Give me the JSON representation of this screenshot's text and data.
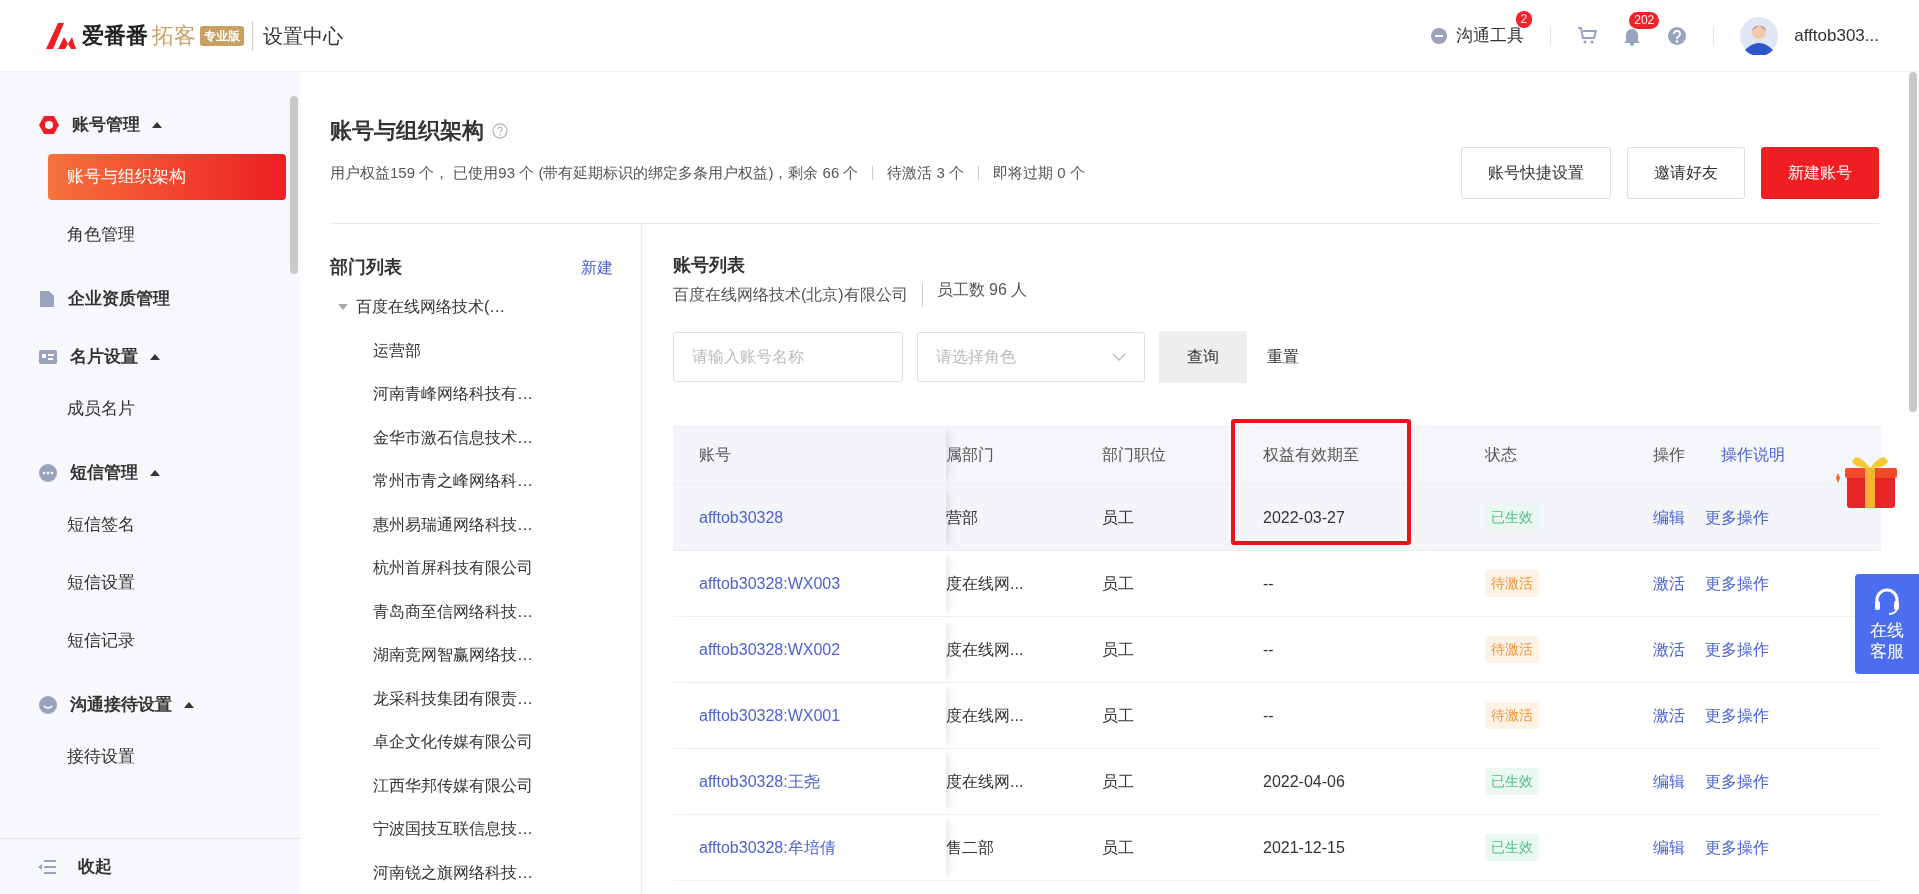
{
  "header": {
    "brand": "爱番番",
    "product": "拓客",
    "edition": "专业版",
    "section": "设置中心",
    "tools_label": "沟通工具",
    "tools_badge": "2",
    "bell_badge": "202",
    "username": "afftob303..."
  },
  "sidebar": {
    "groups": [
      {
        "label": "账号管理",
        "expanded": true,
        "children": [
          {
            "label": "账号与组织架构",
            "selected": true
          },
          {
            "label": "角色管理",
            "selected": false
          }
        ]
      },
      {
        "label": "企业资质管理"
      },
      {
        "label": "名片设置",
        "expanded": true,
        "children": [
          {
            "label": "成员名片",
            "selected": false
          }
        ]
      },
      {
        "label": "短信管理",
        "expanded": true,
        "children": [
          {
            "label": "短信签名",
            "selected": false
          },
          {
            "label": "短信设置",
            "selected": false
          },
          {
            "label": "短信记录",
            "selected": false
          }
        ]
      },
      {
        "label": "沟通接待设置",
        "expanded": true,
        "children": [
          {
            "label": "接待设置",
            "selected": false
          }
        ]
      }
    ],
    "collapse_label": "收起"
  },
  "page": {
    "title": "账号与组织架构",
    "summary": "用户权益159 个， 已使用93 个 (带有延期标识的绑定多条用户权益)，剩余 66 个",
    "pending": "待激活 3 个",
    "expiring": "即将过期 0 个",
    "buttons": [
      {
        "label": "账号快捷设置",
        "primary": false
      },
      {
        "label": "邀请好友",
        "primary": false
      },
      {
        "label": "新建账号",
        "primary": true
      }
    ]
  },
  "departments": {
    "title": "部门列表",
    "new_label": "新建",
    "root": {
      "label": "百度在线网络技术(…",
      "expanded": true,
      "children": [
        {
          "label": "运营部"
        },
        {
          "label": "河南青峰网络科技有…"
        },
        {
          "label": "金华市激石信息技术…"
        },
        {
          "label": "常州市青之峰网络科…"
        },
        {
          "label": "惠州易瑞通网络科技…"
        },
        {
          "label": "杭州首屏科技有限公司"
        },
        {
          "label": "青岛商至信网络科技…"
        },
        {
          "label": "湖南竞网智赢网络技…"
        },
        {
          "label": "龙采科技集团有限责…"
        },
        {
          "label": "卓企文化传媒有限公司"
        },
        {
          "label": "江西华邦传媒有限公司"
        },
        {
          "label": "宁波国技互联信息技…"
        },
        {
          "label": "河南锐之旗网络科技…"
        }
      ]
    }
  },
  "accounts": {
    "title": "账号列表",
    "company": "百度在线网络技术(北京)有限公司",
    "employees": "员工数 96 人",
    "search": {
      "placeholder": "请输入账号名称"
    },
    "role_select": {
      "placeholder": "请选择角色"
    },
    "query_label": "查询",
    "reset_label": "重置",
    "table": {
      "columns": [
        {
          "label": "账号",
          "highlighted": false
        },
        {
          "label": "属部门",
          "highlighted": false
        },
        {
          "label": "部门职位",
          "highlighted": false
        },
        {
          "label": "权益有效期至",
          "highlighted": true
        },
        {
          "label": "状态",
          "highlighted": false
        },
        {
          "label": "操作",
          "highlighted": false,
          "help_link": "操作说明"
        }
      ],
      "rows": [
        {
          "account": "afftob30328",
          "department": "营部",
          "position": "员工",
          "expires": "2022-03-27",
          "status": "已生效",
          "color": "#4cc287",
          "action": "编辑",
          "more": "更多操作",
          "hovered": true,
          "highlighted": true
        },
        {
          "account": "afftob30328:WX003",
          "department": "度在线网...",
          "position": "员工",
          "expires": "--",
          "status": "待激活",
          "color": "#f39334",
          "action": "激活",
          "more": "更多操作",
          "hovered": false,
          "highlighted": false
        },
        {
          "account": "afftob30328:WX002",
          "department": "度在线网...",
          "position": "员工",
          "expires": "--",
          "status": "待激活",
          "color": "#f39334",
          "action": "激活",
          "more": "更多操作",
          "hovered": false,
          "highlighted": false
        },
        {
          "account": "afftob30328:WX001",
          "department": "度在线网...",
          "position": "员工",
          "expires": "--",
          "status": "待激活",
          "color": "#f39334",
          "action": "激活",
          "more": "更多操作",
          "hovered": false,
          "highlighted": false
        },
        {
          "account": "afftob30328:王尧",
          "department": "度在线网...",
          "position": "员工",
          "expires": "2022-04-06",
          "status": "已生效",
          "color": "#4cc287",
          "action": "编辑",
          "more": "更多操作",
          "hovered": false,
          "highlighted": false
        },
        {
          "account": "afftob30328:牟培倩",
          "department": "售二部",
          "position": "员工",
          "expires": "2021-12-15",
          "status": "已生效",
          "color": "#4cc287",
          "action": "编辑",
          "more": "更多操作",
          "hovered": false,
          "highlighted": false
        }
      ]
    }
  },
  "service": {
    "label": "在线客服"
  }
}
